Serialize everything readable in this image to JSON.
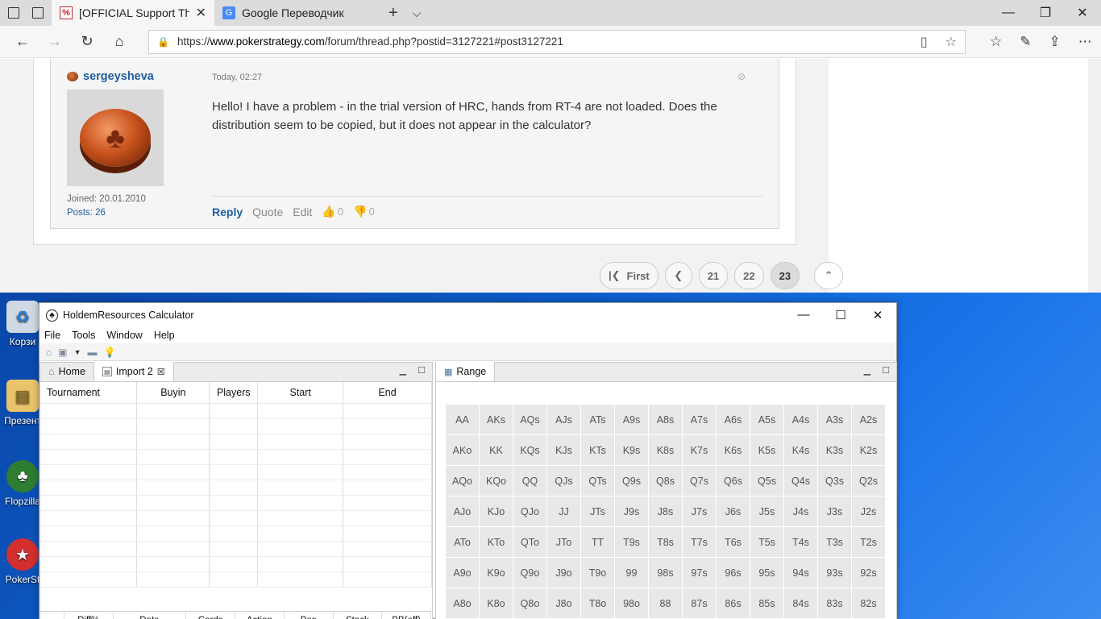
{
  "browser": {
    "tabs": [
      {
        "title": "[OFFICIAL Support Thre",
        "icon": "pokerstrategy-favicon"
      },
      {
        "title": "Google Переводчик",
        "icon": "google-translate-favicon"
      }
    ],
    "url_prefix": "https://",
    "url_host": "www.pokerstrategy.com",
    "url_path": "/forum/thread.php?postid=3127221#post3127221"
  },
  "post": {
    "author": "sergeysheva",
    "time": "Today, 02:27",
    "text": "Hello! I have a problem - in the trial version of HRC, hands from RT-4 are not loaded. Does the distribution seem to be copied, but it does not appear in the calculator?",
    "joined": "Joined: 20.01.2010",
    "posts": "Posts: 26",
    "actions": {
      "reply": "Reply",
      "quote": "Quote",
      "edit": "Edit",
      "likes": "0",
      "dislikes": "0"
    }
  },
  "pager": {
    "first": "First",
    "pages": [
      "21",
      "22",
      "23"
    ],
    "current": "23"
  },
  "desktop": {
    "icons": [
      "Корзи",
      "Презент",
      "Flopzilla",
      "PokerSt"
    ]
  },
  "hrc": {
    "title": "HoldemResources Calculator",
    "menu": [
      "File",
      "Tools",
      "Window",
      "Help"
    ],
    "left_tabs": [
      "Home",
      "Import 2"
    ],
    "right_tab": "Range",
    "columns": [
      "Tournament",
      "Buyin",
      "Players",
      "Start",
      "End"
    ],
    "bottom_columns": [
      "",
      "Diff%",
      "Date",
      "Cards",
      "Action",
      "Pos",
      "Stack",
      "BB(eff)"
    ],
    "range_rows": [
      [
        "AA",
        "AKs",
        "AQs",
        "AJs",
        "ATs",
        "A9s",
        "A8s",
        "A7s",
        "A6s",
        "A5s",
        "A4s",
        "A3s",
        "A2s"
      ],
      [
        "AKo",
        "KK",
        "KQs",
        "KJs",
        "KTs",
        "K9s",
        "K8s",
        "K7s",
        "K6s",
        "K5s",
        "K4s",
        "K3s",
        "K2s"
      ],
      [
        "AQo",
        "KQo",
        "QQ",
        "QJs",
        "QTs",
        "Q9s",
        "Q8s",
        "Q7s",
        "Q6s",
        "Q5s",
        "Q4s",
        "Q3s",
        "Q2s"
      ],
      [
        "AJo",
        "KJo",
        "QJo",
        "JJ",
        "JTs",
        "J9s",
        "J8s",
        "J7s",
        "J6s",
        "J5s",
        "J4s",
        "J3s",
        "J2s"
      ],
      [
        "ATo",
        "KTo",
        "QTo",
        "JTo",
        "TT",
        "T9s",
        "T8s",
        "T7s",
        "T6s",
        "T5s",
        "T4s",
        "T3s",
        "T2s"
      ],
      [
        "A9o",
        "K9o",
        "Q9o",
        "J9o",
        "T9o",
        "99",
        "98s",
        "97s",
        "96s",
        "95s",
        "94s",
        "93s",
        "92s"
      ],
      [
        "A8o",
        "K8o",
        "Q8o",
        "J8o",
        "T8o",
        "98o",
        "88",
        "87s",
        "86s",
        "85s",
        "84s",
        "83s",
        "82s"
      ]
    ]
  }
}
